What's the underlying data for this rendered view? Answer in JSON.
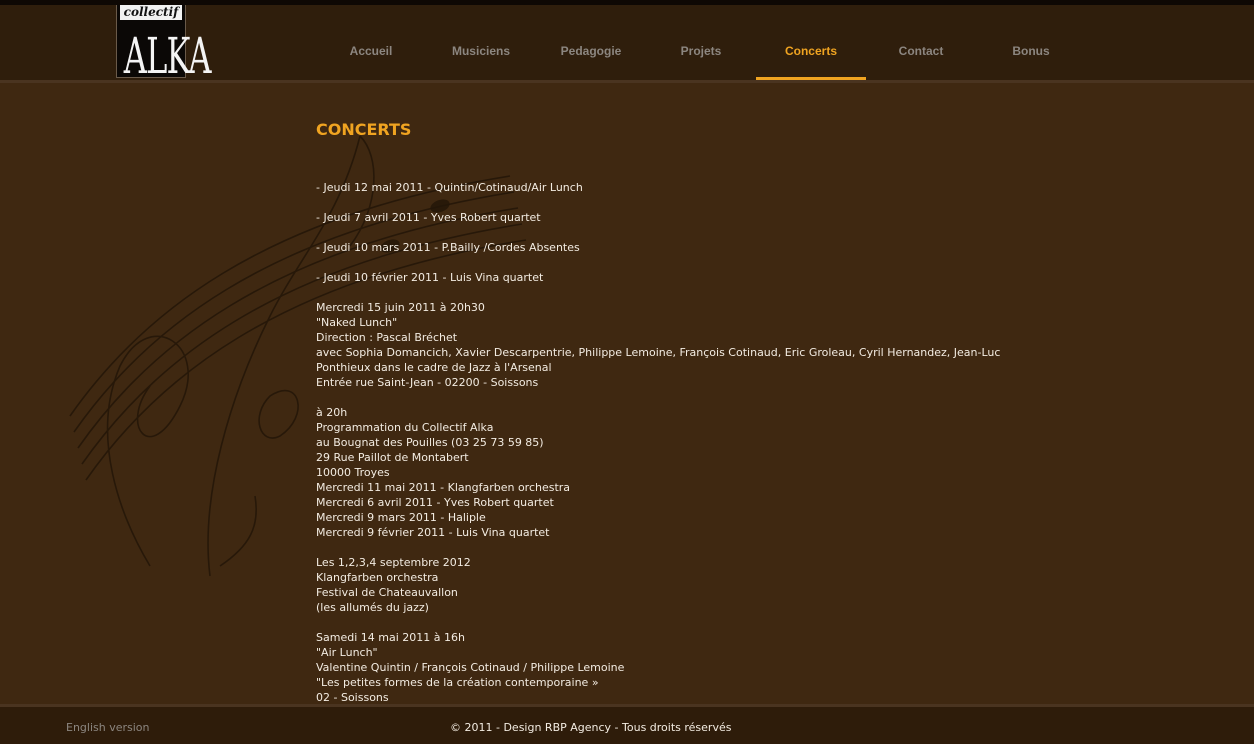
{
  "logo": {
    "top_text": "collectif",
    "main_text": "ALKA"
  },
  "nav": [
    {
      "label": "Accueil"
    },
    {
      "label": "Musiciens"
    },
    {
      "label": "Pedagogie"
    },
    {
      "label": "Projets"
    },
    {
      "label": "Concerts",
      "active": true
    },
    {
      "label": "Contact"
    },
    {
      "label": "Bonus"
    }
  ],
  "page": {
    "title": "CONCERTS",
    "lines": [
      "- Jeudi 12 mai 2011 - Quintin/Cotinaud/Air Lunch",
      "",
      "- Jeudi 7 avril 2011 - Yves Robert quartet",
      "",
      "- Jeudi 10 mars 2011 - P.Bailly /Cordes Absentes",
      "",
      "- Jeudi 10 février 2011 - Luis Vina quartet",
      "",
      "Mercredi 15 juin 2011 à 20h30",
      "\"Naked Lunch\"",
      "Direction : Pascal Bréchet",
      "avec Sophia Domancich, Xavier Descarpentrie, Philippe Lemoine, François Cotinaud, Eric Groleau, Cyril Hernandez, Jean-Luc",
      "Ponthieux dans le cadre de Jazz à l'Arsenal",
      "Entrée rue Saint-Jean - 02200 - Soissons",
      "",
      "à 20h",
      "Programmation du Collectif Alka",
      "au Bougnat des Pouilles (03 25 73 59 85)",
      "29 Rue Paillot de Montabert",
      "10000 Troyes",
      "Mercredi 11 mai 2011 - Klangfarben orchestra",
      "Mercredi 6 avril 2011 - Yves Robert quartet",
      "Mercredi 9 mars 2011 - Haliple",
      "Mercredi 9 février 2011 - Luis Vina quartet",
      "",
      "Les 1,2,3,4 septembre 2012",
      "Klangfarben orchestra",
      "Festival de Chateauvallon",
      "(les allumés du jazz)",
      "",
      "Samedi 14 mai 2011 à 16h",
      "\"Air Lunch\"",
      "Valentine Quintin / François Cotinaud / Philippe Lemoine",
      "\"Les petites formes de la création contemporaine »",
      "02 - Soissons"
    ]
  },
  "footer": {
    "english_link": "English version",
    "copyright": "© 2011 - Design RBP Agency - Tous droits réservés"
  },
  "colors": {
    "accent": "#f0a421",
    "background": "#3f2811",
    "header": "#2f1e0c"
  }
}
